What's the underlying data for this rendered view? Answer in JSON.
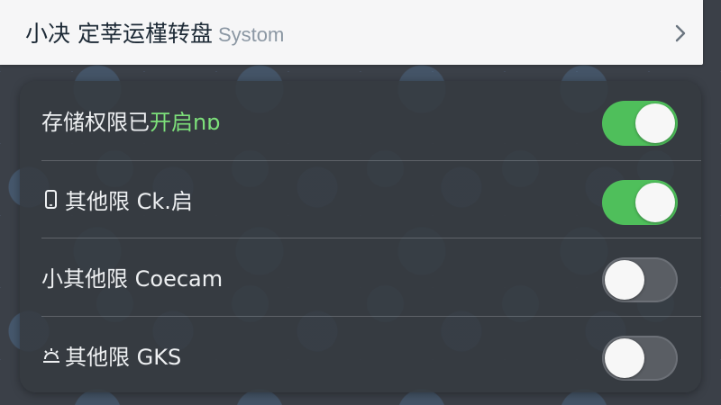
{
  "header": {
    "title": "小决 定莘运槿转盘",
    "subtitle": "Systom"
  },
  "settings": [
    {
      "label_main": "存储权限已",
      "label_accent": "开启nɒ",
      "icon": "",
      "enabled": true
    },
    {
      "label_main": "其他限 Ck.启",
      "label_accent": "",
      "icon": "phone-icon",
      "enabled": true
    },
    {
      "label_main": "小其他限 Coecam",
      "label_accent": "",
      "icon": "",
      "enabled": false
    },
    {
      "label_main": "其他限 GKS",
      "label_accent": "",
      "icon": "sun-dim-icon",
      "enabled": false
    }
  ],
  "colors": {
    "toggle_on": "#4fbf5b",
    "toggle_off": "#5a5e64",
    "accent_text": "#7de07a"
  }
}
